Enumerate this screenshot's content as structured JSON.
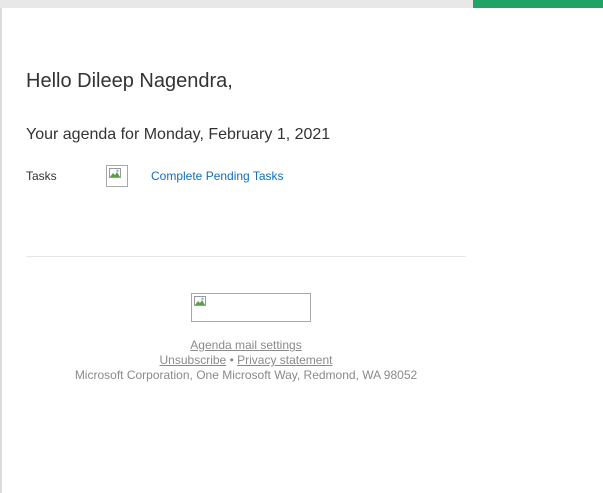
{
  "email": {
    "greeting": "Hello Dileep Nagendra,",
    "agenda_heading": "Your agenda for Monday, February 1, 2021",
    "tasks": {
      "label": "Tasks",
      "image_icon": "broken-image-icon",
      "link_text": "Complete Pending Tasks"
    },
    "footer": {
      "logo_icon": "broken-image-icon",
      "settings_link": "Agenda mail settings",
      "unsubscribe_link": "Unsubscribe",
      "separator": "•",
      "privacy_link": "Privacy statement",
      "address": "Microsoft Corporation, One Microsoft Way, Redmond, WA 98052"
    }
  },
  "colors": {
    "accent": "#21a366",
    "link": "#106ebe",
    "text": "#333333",
    "muted": "#8a8a8a"
  }
}
